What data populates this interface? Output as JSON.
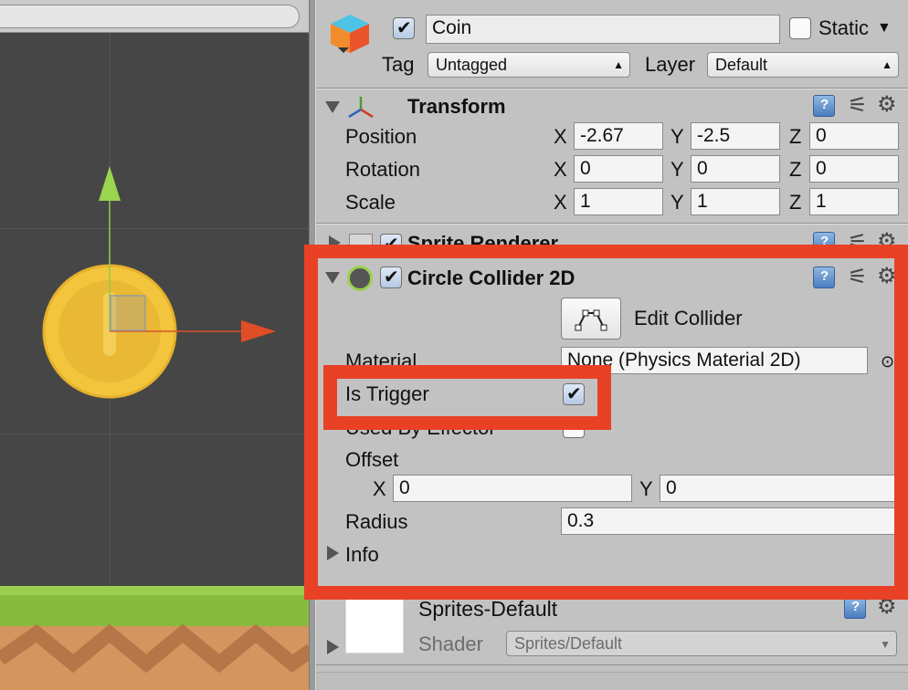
{
  "gameobject": {
    "name": "Coin",
    "active": true,
    "static_label": "Static",
    "static": false,
    "tag_label": "Tag",
    "tag_value": "Untagged",
    "layer_label": "Layer",
    "layer_value": "Default"
  },
  "transform": {
    "title": "Transform",
    "position_label": "Position",
    "rotation_label": "Rotation",
    "scale_label": "Scale",
    "x": "X",
    "y": "Y",
    "z": "Z",
    "position": [
      "-2.67",
      "-2.5",
      "0"
    ],
    "rotation": [
      "0",
      "0",
      "0"
    ],
    "scale": [
      "1",
      "1",
      "1"
    ]
  },
  "sprite_renderer": {
    "title": "Sprite Renderer",
    "enabled": true
  },
  "circle_collider": {
    "title": "Circle Collider 2D",
    "enabled": true,
    "edit_collider_label": "Edit Collider",
    "material_label": "Material",
    "material_value": "None (Physics Material 2D)",
    "is_trigger_label": "Is Trigger",
    "is_trigger": true,
    "used_by_effector_label": "Used By Effector",
    "used_by_effector": false,
    "offset_label": "Offset",
    "offset_x_label": "X",
    "offset_x": "0",
    "offset_y_label": "Y",
    "offset_y": "0",
    "radius_label": "Radius",
    "radius_value": "0.3",
    "info_label": "Info"
  },
  "material": {
    "name": "Sprites-Default",
    "shader_label": "Shader",
    "shader_value": "Sprites/Default"
  },
  "colors": {
    "highlight": "#e84125",
    "coin": "#f2c53d",
    "scene_bg": "#464646",
    "ground_grass": "#8cbf3f"
  }
}
